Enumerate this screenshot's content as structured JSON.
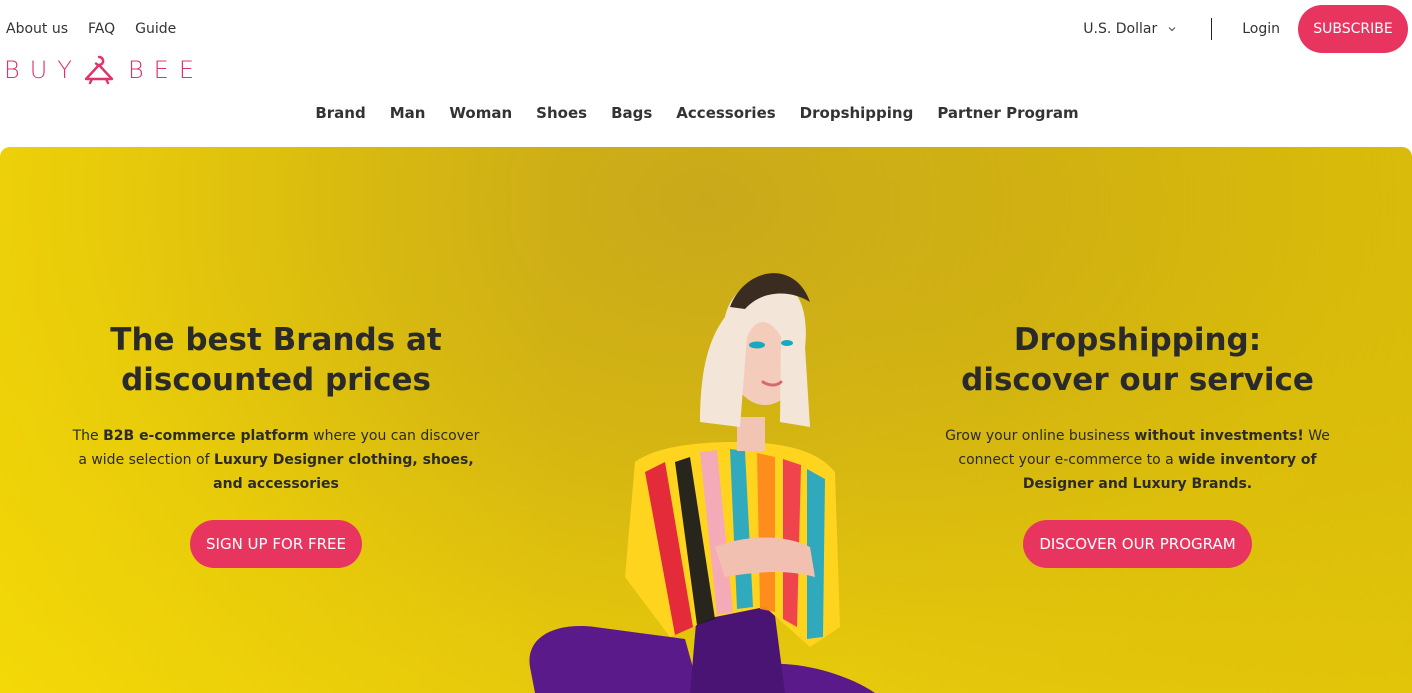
{
  "header": {
    "top_links": [
      "About us",
      "FAQ",
      "Guide"
    ],
    "logo_left": "BUY",
    "logo_right": "BEE",
    "currency": "U.S. Dollar",
    "login": "Login",
    "subscribe": "SUBSCRIBE"
  },
  "nav": [
    "Brand",
    "Man",
    "Woman",
    "Shoes",
    "Bags",
    "Accessories",
    "Dropshipping",
    "Partner Program"
  ],
  "hero": {
    "left": {
      "title_line1": "The best Brands at",
      "title_line2": "discounted prices",
      "p1": "The ",
      "p1_b": "B2B e-commerce platform",
      "p2": " where you can discover a wide selection of ",
      "p2_b": "Luxury Designer clothing, shoes, and accessories",
      "cta": "SIGN UP FOR FREE"
    },
    "right": {
      "title_line1": "Dropshipping:",
      "title_line2": "discover our service",
      "p1": "Grow your online business ",
      "p1_b": "without investments!",
      "p2": " We connect your e-commerce to a ",
      "p2_b": "wide inventory of Designer and Luxury Brands.",
      "cta": "DISCOVER OUR PROGRAM"
    }
  },
  "colors": {
    "accent": "#e8355f",
    "logo": "#e0336c",
    "hero_bg": "#e4c60c"
  }
}
